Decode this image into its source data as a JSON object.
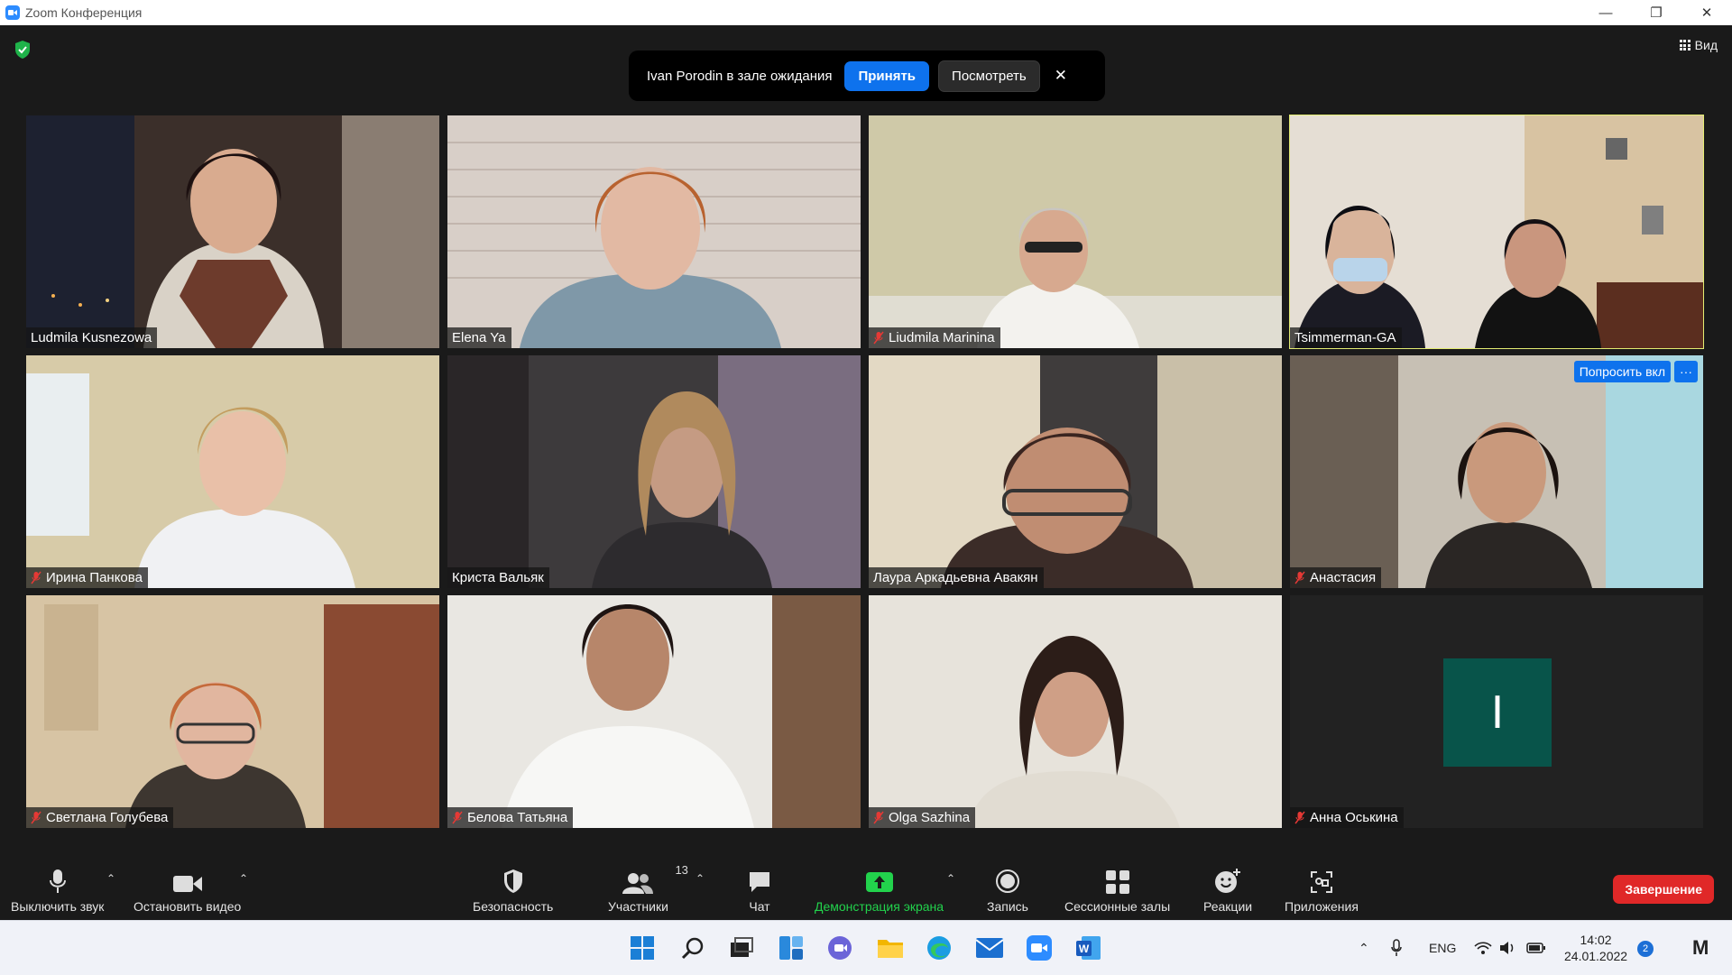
{
  "window": {
    "title": "Zoom Конференция"
  },
  "header": {
    "view_label": "Вид"
  },
  "waiting_room": {
    "message": "Ivan Porodin в зале ожидания",
    "accept_label": "Принять",
    "view_label": "Посмотреть",
    "close_glyph": "✕"
  },
  "tiles": [
    {
      "name": "Ludmila Kusnezowa",
      "muted": false
    },
    {
      "name": "Elena Ya",
      "muted": false
    },
    {
      "name": "Liudmila Marinina",
      "muted": true
    },
    {
      "name": "Tsimmerman-GA",
      "muted": false,
      "active_speaker": true
    },
    {
      "name": "Ирина Панкова",
      "muted": true
    },
    {
      "name": "Криста Вальяк",
      "muted": false
    },
    {
      "name": "Лаура Аркадьевна Авакян",
      "muted": false
    },
    {
      "name": "Анастасия",
      "muted": true,
      "ask_label": "Попросить вкл",
      "more_label": "···"
    },
    {
      "name": "Светлана Голубева",
      "muted": true
    },
    {
      "name": "Белова Татьяна",
      "muted": true
    },
    {
      "name": "Olga Sazhina",
      "muted": true
    },
    {
      "name": "Анна Оськина",
      "muted": true,
      "avatar_letter": "I",
      "video_off": true
    }
  ],
  "toolbar": {
    "mute_label": "Выключить звук",
    "video_label": "Остановить видео",
    "security_label": "Безопасность",
    "participants_label": "Участники",
    "participants_count": "13",
    "chat_label": "Чат",
    "share_label": "Демонстрация экрана",
    "record_label": "Запись",
    "breakout_label": "Сессионные залы",
    "reactions_label": "Реакции",
    "apps_label": "Приложения",
    "end_label": "Завершение"
  },
  "taskbar": {
    "lang": "ENG",
    "time": "14:02",
    "date": "24.01.2022",
    "notifications": "2"
  },
  "colors": {
    "accent": "#0e72ed",
    "share_green": "#22d24c",
    "end_red": "#e02828",
    "active_speaker": "#e3ec72",
    "avatar_bg": "#08544a"
  }
}
